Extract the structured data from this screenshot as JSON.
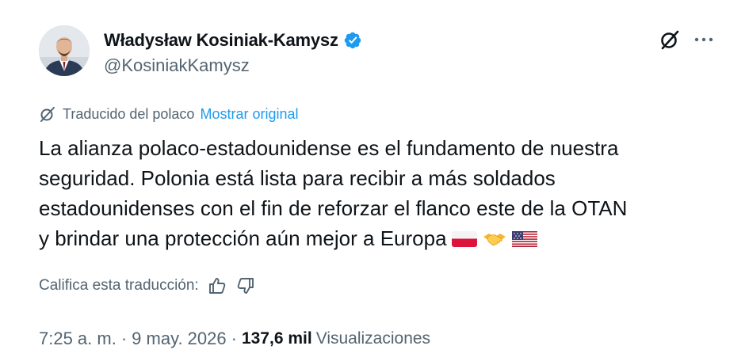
{
  "author": {
    "display_name": "Władysław Kosiniak-Kamysz",
    "handle": "@KosiniakKamysz",
    "verified": true
  },
  "icons": {
    "avatar": "profile-photo",
    "verified": "verified-badge-icon",
    "grok": "grok-icon",
    "more": "more-options-icon",
    "translate": "translate-icon",
    "thumbs_up": "thumbs-up-icon",
    "thumbs_down": "thumbs-down-icon"
  },
  "translation": {
    "label": "Traducido del polaco",
    "show_original": "Mostrar original"
  },
  "tweet": {
    "lines": [
      "La alianza polaco-estadounidense es el fundamento de nuestra",
      "seguridad. Polonia está lista para recibir a más soldados",
      "estadounidenses con el fin de reforzar el flanco este de la OTAN",
      "y brindar una protección aún mejor a Europa"
    ],
    "emojis": [
      "flag-poland",
      "handshake",
      "flag-united-states"
    ]
  },
  "rating": {
    "label": "Califica esta traducción:"
  },
  "meta": {
    "time": "7:25 a. m.",
    "separator": "·",
    "date": "9 may. 2026",
    "views_count": "137,6 mil",
    "views_label": "Visualizaciones"
  },
  "colors": {
    "text_primary": "#0f1419",
    "text_secondary": "#536471",
    "link": "#1d9bf0",
    "verified": "#1d9bf0"
  }
}
